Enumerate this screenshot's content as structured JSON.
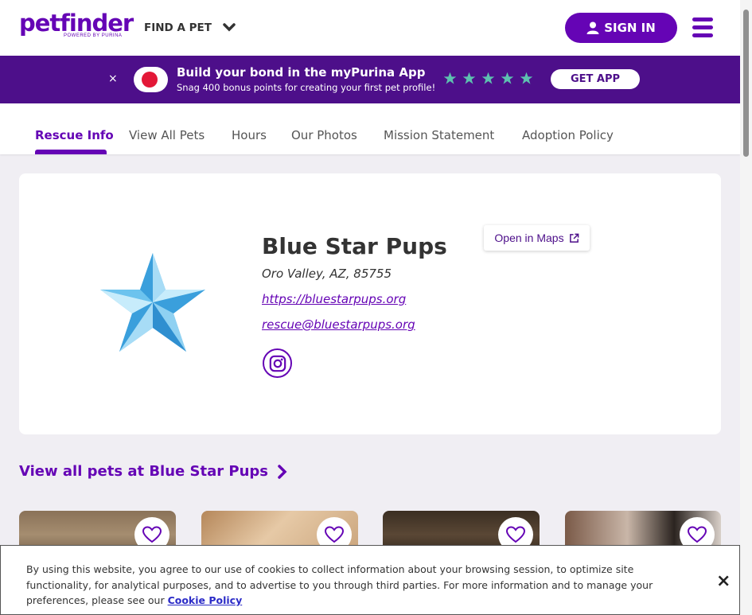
{
  "header": {
    "logo_text": "petfinder",
    "logo_sub": "POWERED BY PURINA",
    "find_pet_label": "FIND A PET",
    "signin_label": "SIGN IN"
  },
  "promo": {
    "close_label": "×",
    "title": "Build your bond in the myPurina App",
    "subtitle": "Snag 400 bonus points for creating your first pet profile!",
    "rating_stars": 5,
    "cta_label": "GET APP"
  },
  "tabs": [
    {
      "label": "Rescue Info",
      "active": true
    },
    {
      "label": "View All Pets"
    },
    {
      "label": "Hours"
    },
    {
      "label": "Our Photos"
    },
    {
      "label": "Mission Statement"
    },
    {
      "label": "Adoption Policy"
    }
  ],
  "rescue": {
    "name": "Blue Star Pups",
    "location": "Oro Valley, AZ, 85755",
    "website": "https://bluestarpups.org",
    "email": "rescue@bluestarpups.org",
    "maps_label": "Open in Maps"
  },
  "view_all_label": "View all pets at Blue Star Pups",
  "cookie": {
    "text": "By using this website, you agree to our use of cookies to collect information about your browsing session, to optimize site functionality, for analytical purposes, and to advertise to you through third parties. For more information and to manage your preferences, please see our",
    "link_label": "Cookie Policy",
    "close_label": "×"
  },
  "colors": {
    "brand": "#6504b5",
    "banner": "#4d0f8a",
    "star": "#5dc0b0"
  }
}
